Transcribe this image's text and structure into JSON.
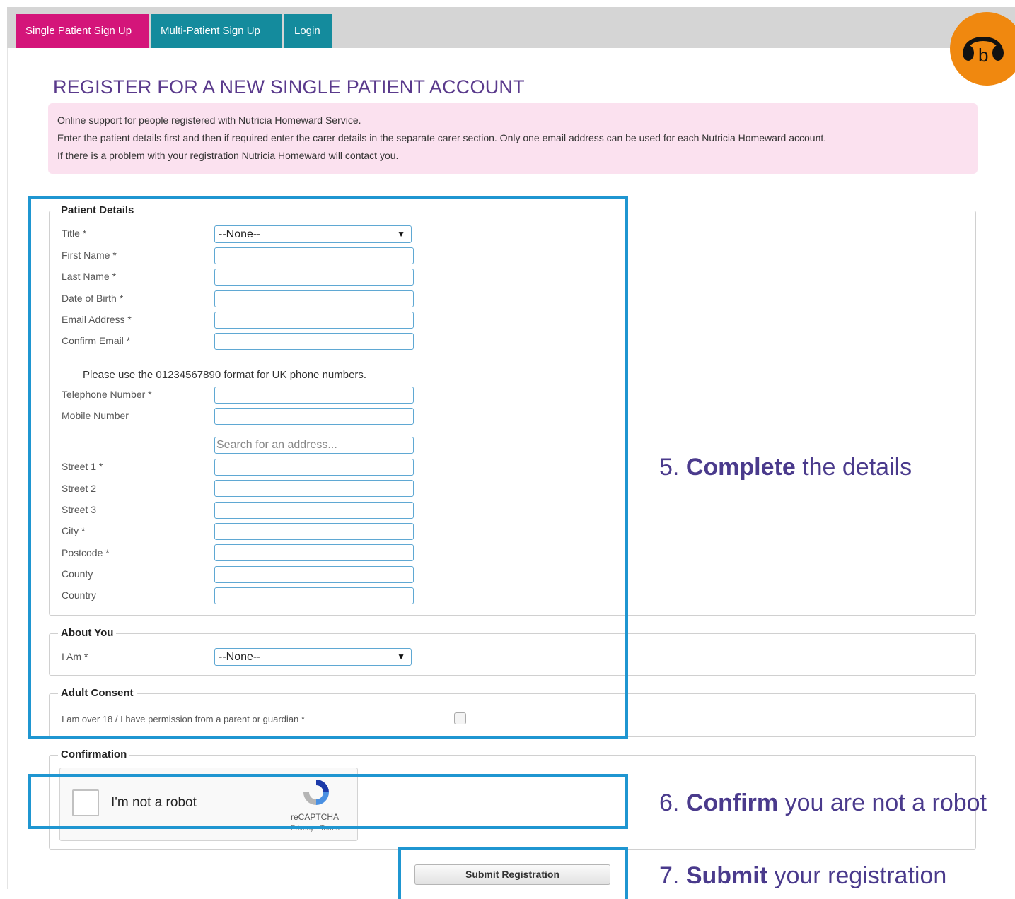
{
  "tabs": {
    "single": "Single Patient Sign Up",
    "multi": "Multi-Patient Sign Up",
    "login": "Login"
  },
  "logo": {
    "icon": "headphones-b-icon",
    "color": "#f0880f"
  },
  "heading": "REGISTER FOR A NEW SINGLE PATIENT ACCOUNT",
  "info": {
    "line1": "Online support for people registered with Nutricia Homeward Service.",
    "line2": "Enter the patient details first and then if required enter the carer details in the separate carer section. Only one email address can be used for each Nutricia Homeward account.",
    "line3": "If there is a problem with your registration Nutricia Homeward will contact you."
  },
  "patient": {
    "legend": "Patient Details",
    "title_label": "Title *",
    "title_value": "--None--",
    "first_name": "First Name *",
    "last_name": "Last Name *",
    "dob": "Date of Birth *",
    "email": "Email Address *",
    "confirm_email": "Confirm Email *",
    "phone_note": "Please use the 01234567890 format for UK phone numbers.",
    "telephone": "Telephone Number *",
    "mobile": "Mobile Number",
    "address_search_placeholder": "Search for an address...",
    "street1": "Street 1 *",
    "street2": "Street 2",
    "street3": "Street 3",
    "city": "City *",
    "postcode": "Postcode *",
    "county": "County",
    "country": "Country"
  },
  "about": {
    "legend": "About You",
    "label": "I Am *",
    "value": "--None--"
  },
  "consent": {
    "legend": "Adult Consent",
    "label": "I am over 18 / I have permission from a parent or guardian *"
  },
  "confirmation": {
    "legend": "Confirmation",
    "captcha_text": "I'm not a robot",
    "captcha_brand": "reCAPTCHA",
    "captcha_terms": "Privacy - Terms"
  },
  "submit_label": "Submit Registration",
  "callouts": {
    "c5": {
      "num": "5.",
      "bold": "Complete",
      "rest": "the details"
    },
    "c6": {
      "num": "6.",
      "bold": "Confirm",
      "rest": "you are not a robot"
    },
    "c7": {
      "num": "7.",
      "bold": "Submit",
      "rest": "your registration"
    }
  },
  "colors": {
    "pink_tab": "#d4157a",
    "teal_tab": "#148b9d",
    "highlight": "#1f96d1",
    "heading": "#5a3a8c"
  }
}
